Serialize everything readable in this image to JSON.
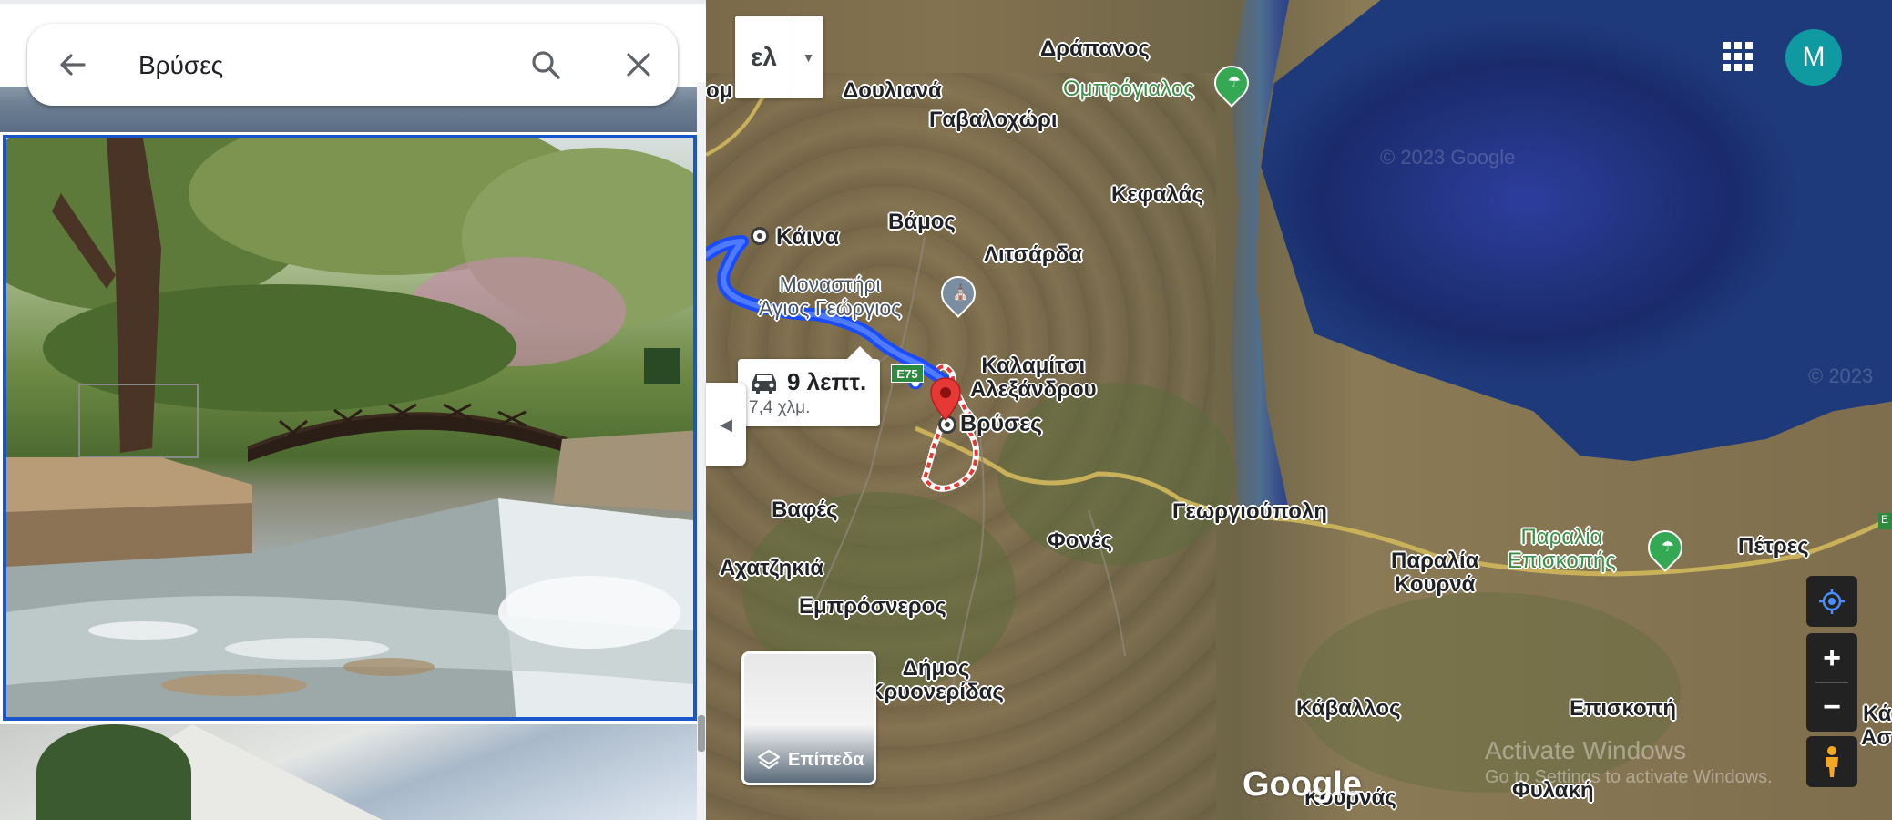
{
  "search": {
    "query": "Βρύσες"
  },
  "language": {
    "code": "ελ"
  },
  "route": {
    "time": "9 λεπτ.",
    "distance": "7,4 χλμ.",
    "road_shield": "E75"
  },
  "layers": {
    "label": "Επίπεδα"
  },
  "account": {
    "initial": "M"
  },
  "places": {
    "drapanos": "Δράπανος",
    "doulianа": "Δουλιανά",
    "gavalochori": "Γαβαλοχώρι",
    "ombrogialos": "Ομπρόγιαλος",
    "kefalas": "Κεφαλάς",
    "vamos": "Βάμος",
    "kaina": "Κάινα",
    "litsarda": "Λιτσάρδα",
    "monastery_l1": "Μοναστήρι",
    "monastery_l2": "Άγιος Γεώργιος",
    "kalamitsi_l1": "Καλαμίτσι",
    "kalamitsi_l2": "Αλεξάνδρου",
    "vryses": "Βρύσες",
    "vafes": "Βαφές",
    "georgioupoli": "Γεωργιούπολη",
    "fones": "Φονές",
    "achatzikia": "Αχατζηκιά",
    "emprosneros": "Εμπρόσνερος",
    "paralia_kourna_l1": "Παραλία",
    "paralia_kourna_l2": "Κουρνά",
    "paralia_episkopis_l1": "Παραλία",
    "paralia_episkopis_l2": "Επισκοπής",
    "petres": "Πέτρες",
    "dimos_l1": "Δήμος",
    "dimos_l2": "Κρυονερίδας",
    "kavallos": "Κάβαλλος",
    "episkopi": "Επισκοπή",
    "kournas": "Κουρνάς",
    "fylaki": "Φυλακή",
    "edge_left": "ομ",
    "edge_right_1": "Κά",
    "edge_right_2": "Ασ"
  },
  "map": {
    "copyright_1": "© 2023 Google",
    "copyright_2": "© 2023",
    "logo": "Google",
    "activate_title": "Activate Windows",
    "activate_sub": "Go to Settings to activate Windows.",
    "route_color": "#1a4bff",
    "marker_color": "#e53935",
    "boundary_color": "#e53935"
  }
}
